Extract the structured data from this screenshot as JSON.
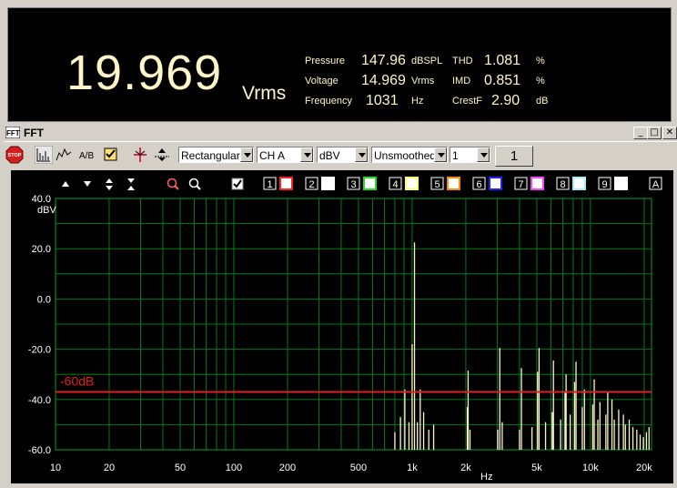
{
  "meter": {
    "main_value": "19.969",
    "main_unit": "Vrms",
    "readings": [
      {
        "label": "Pressure",
        "value": "147.96",
        "unit": "dBSPL"
      },
      {
        "label": "Voltage",
        "value": "14.969",
        "unit": "Vrms"
      },
      {
        "label": "Frequency",
        "value": "1031",
        "unit": "Hz"
      }
    ],
    "readings2": [
      {
        "label": "THD",
        "value": "1.081",
        "unit": "%"
      },
      {
        "label": "IMD",
        "value": "0.851",
        "unit": "%"
      },
      {
        "label": "CrestF",
        "value": "2.90",
        "unit": "dB"
      }
    ]
  },
  "window": {
    "title": "FFT",
    "icon_label": "FFT",
    "minimize": "_",
    "maximize": "□",
    "close": "✕"
  },
  "toolbar": {
    "stop_label": "STOP",
    "window_select": "Rectangular",
    "channel_select": "CH A",
    "unit_select": "dBV",
    "smoothing_select": "Unsmoothed",
    "average_select": "1",
    "count_display": "1",
    "ab_label": "A/B"
  },
  "channels": [
    {
      "num": "1",
      "color": "#ff2020"
    },
    {
      "num": "2",
      "color": "#ffffff"
    },
    {
      "num": "3",
      "color": "#20e020"
    },
    {
      "num": "4",
      "color": "#ffff60"
    },
    {
      "num": "5",
      "color": "#ff8c00"
    },
    {
      "num": "6",
      "color": "#2020ff"
    },
    {
      "num": "7",
      "color": "#ff40ff"
    },
    {
      "num": "8",
      "color": "#a0f0ff"
    },
    {
      "num": "9",
      "color": "#ffffff"
    }
  ],
  "channel_all_label": "A",
  "chart_data": {
    "type": "line",
    "x_scale": "log",
    "xlim": [
      10,
      22000
    ],
    "ylim": [
      -60,
      40
    ],
    "ylabel": "dBV",
    "xlabel": "Hz",
    "x_ticks": [
      {
        "v": 10,
        "label": "10"
      },
      {
        "v": 20,
        "label": "20"
      },
      {
        "v": 50,
        "label": "50"
      },
      {
        "v": 100,
        "label": "100"
      },
      {
        "v": 200,
        "label": "200"
      },
      {
        "v": 500,
        "label": "500"
      },
      {
        "v": 1000,
        "label": "1k"
      },
      {
        "v": 2000,
        "label": "2k"
      },
      {
        "v": 5000,
        "label": "5k"
      },
      {
        "v": 10000,
        "label": "10k"
      },
      {
        "v": 20000,
        "label": "20k"
      }
    ],
    "y_ticks": [
      {
        "v": 40,
        "label": "40.0"
      },
      {
        "v": 20,
        "label": "20.0"
      },
      {
        "v": 0,
        "label": "0.0"
      },
      {
        "v": -20,
        "label": "-20.0"
      },
      {
        "v": -40,
        "label": "-40.0"
      },
      {
        "v": -60,
        "label": "-60.0"
      }
    ],
    "threshold": {
      "value": -37,
      "label": "-60dB",
      "color": "#e02020"
    },
    "grid": true,
    "trace_color": "#fff6c8",
    "peaks": [
      [
        800,
        -53
      ],
      [
        860,
        -47
      ],
      [
        910,
        -36
      ],
      [
        960,
        -49
      ],
      [
        1000,
        -18
      ],
      [
        1031,
        22.5
      ],
      [
        1070,
        -49
      ],
      [
        1110,
        -36
      ],
      [
        1160,
        -45
      ],
      [
        1240,
        -52
      ],
      [
        1320,
        -50
      ],
      [
        2040,
        -43
      ],
      [
        2060,
        -28.5
      ],
      [
        2110,
        -52
      ],
      [
        3020,
        -52
      ],
      [
        3100,
        -19.5
      ],
      [
        3200,
        -49
      ],
      [
        4000,
        -52
      ],
      [
        4100,
        -27.5
      ],
      [
        4700,
        -51
      ],
      [
        5050,
        -29
      ],
      [
        5150,
        -19.5
      ],
      [
        5600,
        -49
      ],
      [
        6100,
        -45
      ],
      [
        6200,
        -24.5
      ],
      [
        6800,
        -48
      ],
      [
        7200,
        -37
      ],
      [
        7300,
        -30
      ],
      [
        7700,
        -46
      ],
      [
        8150,
        -33
      ],
      [
        8300,
        -25
      ],
      [
        9000,
        -43
      ],
      [
        9250,
        -36
      ],
      [
        10300,
        -42
      ],
      [
        10500,
        -32
      ],
      [
        11000,
        -48
      ],
      [
        11300,
        -41
      ],
      [
        12200,
        -46
      ],
      [
        12500,
        -37
      ],
      [
        13200,
        -40
      ],
      [
        13600,
        -48
      ],
      [
        14400,
        -44
      ],
      [
        15300,
        -46
      ],
      [
        15700,
        -50
      ],
      [
        16500,
        -48
      ],
      [
        17300,
        -51
      ],
      [
        18200,
        -52
      ],
      [
        19000,
        -54
      ],
      [
        19800,
        -55
      ],
      [
        20600,
        -53
      ],
      [
        21300,
        -51
      ]
    ]
  }
}
